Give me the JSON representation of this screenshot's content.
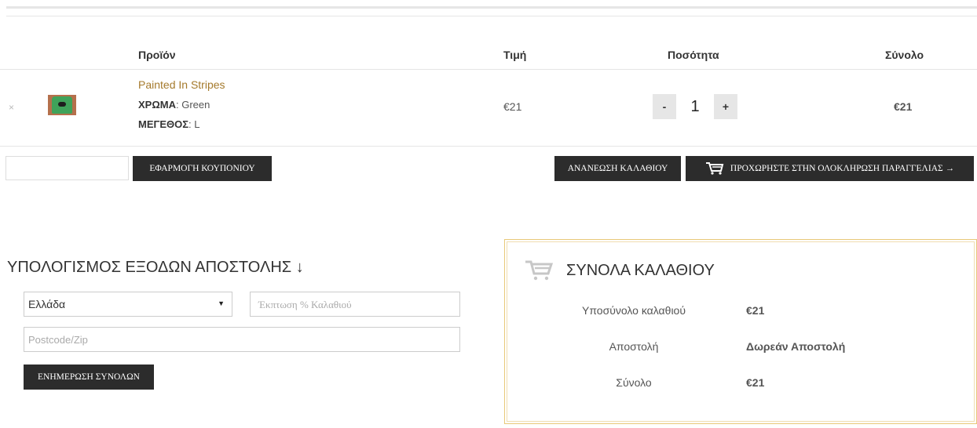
{
  "cart_table": {
    "headers": {
      "product": "Προϊόν",
      "price": "Τιμή",
      "quantity": "Ποσότητα",
      "total": "Σύνολο"
    },
    "item": {
      "remove_icon": "×",
      "name": "Painted In Stripes",
      "attrs": [
        {
          "label": "ΧΡΩΜΑ",
          "value": "Green"
        },
        {
          "label": "ΜΕΓΕΘΟΣ",
          "value": "L"
        }
      ],
      "price": "€21",
      "qty_minus": "-",
      "qty_value": "1",
      "qty_plus": "+",
      "total": "€21"
    }
  },
  "actions": {
    "apply_coupon": "ΕΦΑΡΜΟΓΗ ΚΟΥΠΟΝΙΟΥ",
    "update_cart": "ΑΝΑΝΕΩΣΗ ΚΑΛΑΘΙΟΥ",
    "checkout": "ΠΡΟΧΩΡΗΣΤΕ ΣΤΗΝ ΟΛΟΚΛΗΡΩΣΗ ΠΑΡΑΓΓΕΛΙΑΣ →"
  },
  "shipping": {
    "title": "ΥΠΟΛΟΓΙΣΜΟΣ ΕΞΟΔΩΝ ΑΠΟΣΤΟΛΗΣ ↓",
    "country": "Ελλάδα",
    "discount_placeholder": "Έκπτωση % Καλαθιού",
    "postcode_placeholder": "Postcode/Zip",
    "update_totals": "ΕΝΗΜΕΡΩΣΗ ΣΥΝΟΛΩΝ"
  },
  "totals": {
    "title": "ΣΥΝΟΛΑ ΚΑΛΑΘΙΟΥ",
    "rows": [
      {
        "label": "Υποσύνολο καλαθιού",
        "value": "€21"
      },
      {
        "label": "Αποστολή",
        "value": "Δωρεάν Αποστολή"
      },
      {
        "label": "Σύνολο",
        "value": "€21"
      }
    ]
  },
  "colors": {
    "link": "#a57a2c",
    "dark_button": "#2c2c2c",
    "box_border": "#e8c979"
  },
  "icons": [
    "remove-icon",
    "cart-icon",
    "select-arrow-icon"
  ]
}
